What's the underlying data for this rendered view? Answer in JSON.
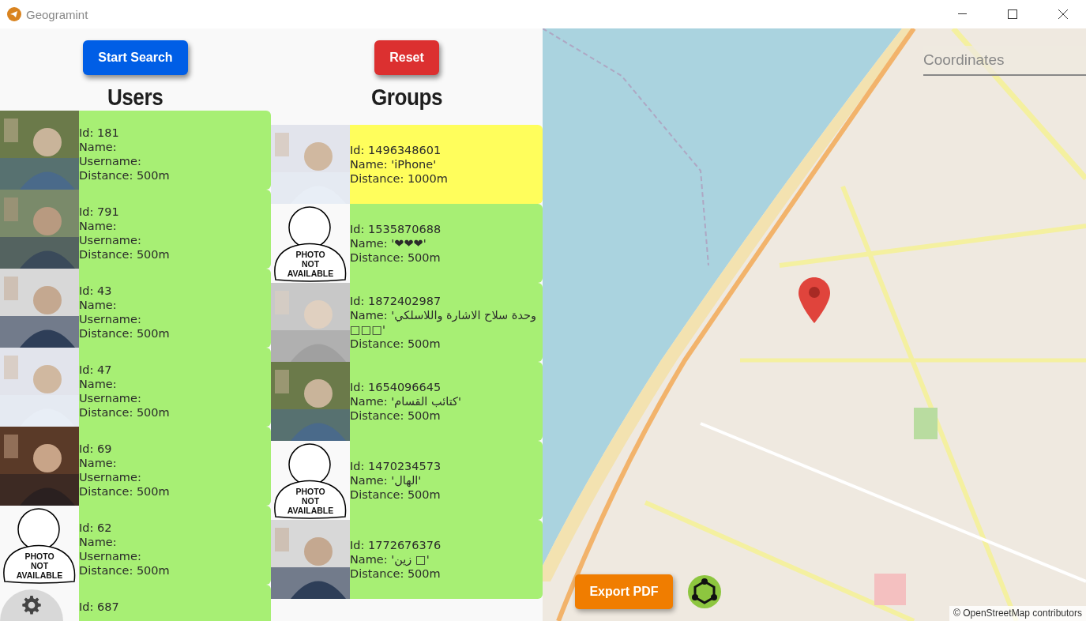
{
  "window": {
    "title": "Geogramint"
  },
  "buttons": {
    "start": "Start Search",
    "reset": "Reset"
  },
  "users": {
    "heading": "Users",
    "items": [
      {
        "photo": {
          "kind": "picture"
        },
        "lines": [
          "Id: 181",
          "Name:",
          "Username:",
          "Distance: 500m"
        ],
        "color": "#a7ef74"
      },
      {
        "photo": {
          "kind": "picture"
        },
        "lines": [
          "Id: 791",
          "Name:",
          "Username:",
          "Distance: 500m"
        ],
        "color": "#a7ef74"
      },
      {
        "photo": {
          "kind": "picture"
        },
        "lines": [
          "Id: 43",
          "Name:",
          "Username:",
          "Distance: 500m"
        ],
        "color": "#a7ef74"
      },
      {
        "photo": {
          "kind": "picture"
        },
        "lines": [
          "Id: 47",
          "Name:",
          "Username:",
          "Distance: 500m"
        ],
        "color": "#a7ef74"
      },
      {
        "photo": {
          "kind": "picture"
        },
        "lines": [
          "Id: 69",
          "Name:",
          "Username:",
          "Distance: 500m"
        ],
        "color": "#a7ef74"
      },
      {
        "photo": {
          "kind": "no_photo",
          "text": [
            "PHOTO",
            "NOT",
            "AVAILABLE"
          ]
        },
        "lines": [
          "Id: 62",
          "Name:",
          "Username:",
          "Distance: 500m"
        ],
        "color": "#a7ef74"
      },
      {
        "photo": {
          "kind": "blank"
        },
        "lines": [
          "Id: 687"
        ],
        "color": "#a7ef74"
      }
    ]
  },
  "groups": {
    "heading": "Groups",
    "items": [
      {
        "photo": {
          "kind": "picture"
        },
        "lines": [
          "Id: 1496348601",
          "Name: 'iPhone'",
          "Distance: 1000m"
        ],
        "color": "#fffe5c"
      },
      {
        "photo": {
          "kind": "no_photo",
          "text": [
            "PHOTO",
            "NOT",
            "AVAILABLE"
          ]
        },
        "lines": [
          "Id: 1535870688",
          "Name: '❤❤❤'",
          "Distance: 500m"
        ],
        "color": "#a7ef74"
      },
      {
        "photo": {
          "kind": "picture"
        },
        "lines": [
          "Id: 1872402987",
          "Name: 'وحدة سلاح الاشارة واللاسلكي □□□'",
          "Distance: 500m"
        ],
        "color": "#a7ef74"
      },
      {
        "photo": {
          "kind": "picture"
        },
        "lines": [
          "Id: 1654096645",
          "Name: 'كتائب القسام'",
          "Distance: 500m"
        ],
        "color": "#a7ef74"
      },
      {
        "photo": {
          "kind": "no_photo",
          "text": [
            "PHOTO",
            "NOT",
            "AVAILABLE"
          ]
        },
        "lines": [
          "Id: 1470234573",
          "Name: 'الهال'",
          "Distance: 500m"
        ],
        "color": "#a7ef74"
      },
      {
        "photo": {
          "kind": "picture"
        },
        "lines": [
          "Id: 1772676376",
          "Name: 'زين □'",
          "Distance: 500m"
        ],
        "color": "#a7ef74"
      }
    ]
  },
  "map": {
    "coordinates_placeholder": "Coordinates",
    "export_button": "Export PDF",
    "attribution": "© OpenStreetMap contributors"
  }
}
